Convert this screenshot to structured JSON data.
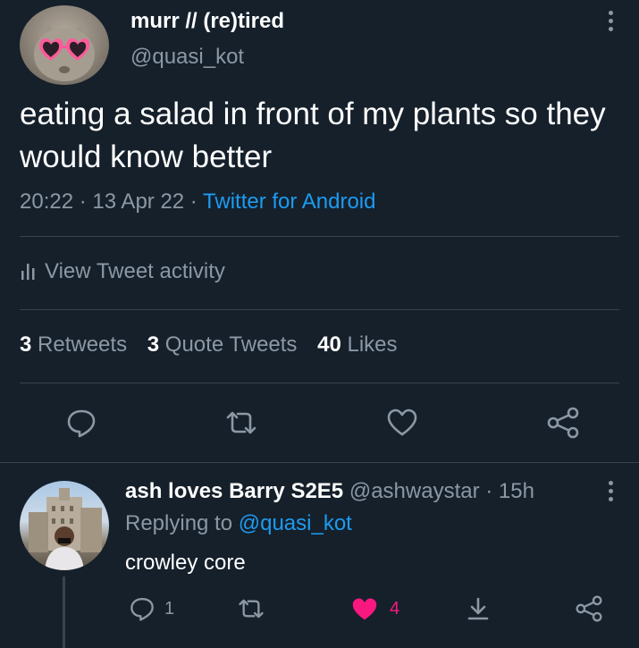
{
  "tweet": {
    "display_name": "murr // (re)tired",
    "handle": "@quasi_kot",
    "text": "eating a salad in front of my plants so they would know better",
    "time": "20:22",
    "date": "13 Apr 22",
    "source": "Twitter for Android",
    "activity_label": "View Tweet activity",
    "stats": {
      "retweets_count": "3",
      "retweets_label": "Retweets",
      "quotes_count": "3",
      "quotes_label": "Quote Tweets",
      "likes_count": "40",
      "likes_label": "Likes"
    }
  },
  "reply": {
    "display_name": "ash loves Barry S2E5",
    "handle": "@ashwaystar",
    "age": "15h",
    "replying_to_prefix": "Replying to",
    "replying_to_handle": "@quasi_kot",
    "text": "crowley core",
    "reply_count": "1",
    "like_count": "4"
  },
  "icons": {
    "more": "more-vertical-icon",
    "activity": "bar-chart-icon",
    "reply": "comment-icon",
    "retweet": "retweet-icon",
    "like": "heart-icon",
    "share": "share-icon",
    "bookmark": "download-icon"
  },
  "colors": {
    "background": "#15202b",
    "muted": "#8b98a5",
    "link": "#1d9bf0",
    "like_active": "#f91880",
    "divider": "#38444d"
  }
}
